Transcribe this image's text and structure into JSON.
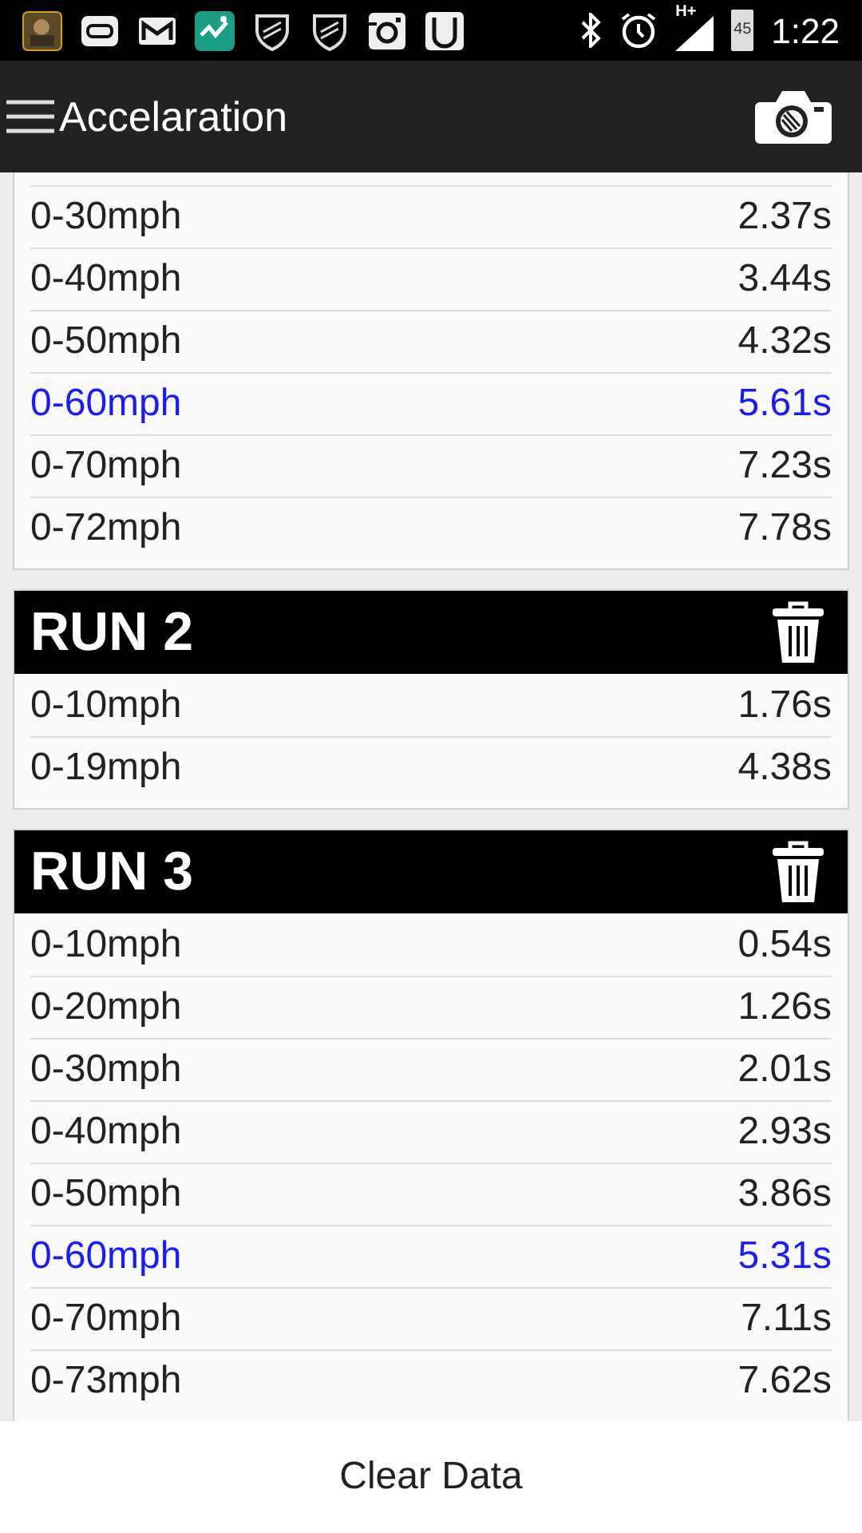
{
  "status_bar": {
    "notifications": [
      {
        "kind": "game"
      },
      {
        "kind": "pill"
      },
      {
        "kind": "mail"
      },
      {
        "kind": "fitness"
      },
      {
        "kind": "shield"
      },
      {
        "kind": "shield"
      },
      {
        "kind": "camera"
      },
      {
        "kind": "cup"
      }
    ],
    "network": "H+",
    "battery": "45",
    "time": "1:22"
  },
  "app_bar": {
    "title": "Accelaration"
  },
  "runs": [
    {
      "rows": [
        {
          "label": "0-30mph",
          "time": "2.37s",
          "highlight": false
        },
        {
          "label": "0-40mph",
          "time": "3.44s",
          "highlight": false
        },
        {
          "label": "0-50mph",
          "time": "4.32s",
          "highlight": false
        },
        {
          "label": "0-60mph",
          "time": "5.61s",
          "highlight": true
        },
        {
          "label": "0-70mph",
          "time": "7.23s",
          "highlight": false
        },
        {
          "label": "0-72mph",
          "time": "7.78s",
          "highlight": false
        }
      ]
    },
    {
      "title": "RUN 2",
      "rows": [
        {
          "label": "0-10mph",
          "time": "1.76s",
          "highlight": false
        },
        {
          "label": "0-19mph",
          "time": "4.38s",
          "highlight": false
        }
      ]
    },
    {
      "title": "RUN 3",
      "rows": [
        {
          "label": "0-10mph",
          "time": "0.54s",
          "highlight": false
        },
        {
          "label": "0-20mph",
          "time": "1.26s",
          "highlight": false
        },
        {
          "label": "0-30mph",
          "time": "2.01s",
          "highlight": false
        },
        {
          "label": "0-40mph",
          "time": "2.93s",
          "highlight": false
        },
        {
          "label": "0-50mph",
          "time": "3.86s",
          "highlight": false
        },
        {
          "label": "0-60mph",
          "time": "5.31s",
          "highlight": true
        },
        {
          "label": "0-70mph",
          "time": "7.11s",
          "highlight": false
        },
        {
          "label": "0-73mph",
          "time": "7.62s",
          "highlight": false
        }
      ]
    }
  ],
  "footer_button": "Clear Data"
}
